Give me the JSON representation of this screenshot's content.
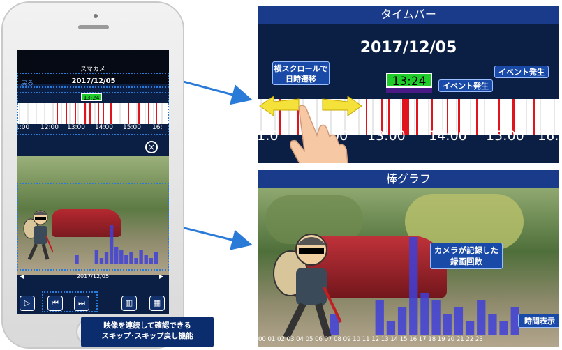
{
  "phone": {
    "app_title": "スマカメ",
    "back_label": "戻る",
    "date": "2017/12/05",
    "now_time": "13:24",
    "time_labels": [
      "1:00",
      "12:00",
      "13:00",
      "14:00",
      "15:00",
      "16:"
    ],
    "close_icon": "close-circle-icon",
    "chart_date": "2017/12/05",
    "nav_prev": "◀",
    "nav_next": "▶",
    "buttons": [
      {
        "name": "play-button",
        "icon": "play-icon",
        "glyph": "▷"
      },
      {
        "name": "skip-back-button",
        "icon": "skip-back-icon",
        "glyph": "⏮"
      },
      {
        "name": "skip-forward-button",
        "icon": "skip-forward-icon",
        "glyph": "⏭"
      },
      {
        "name": "bar-chart-button",
        "icon": "bar-chart-icon",
        "glyph": "▥"
      },
      {
        "name": "calendar-button",
        "icon": "calendar-icon",
        "glyph": "▦"
      }
    ]
  },
  "callout_bottom": {
    "line1": "映像を連続して確認できる",
    "line2": "スキップ･スキップ戻し機能"
  },
  "timebar_panel": {
    "title": "タイムバー",
    "date": "2017/12/05",
    "now_time": "13:24",
    "scroll_tip_line1": "横スクロールで",
    "scroll_tip_line2": "日時遷移",
    "event1": "イベント発生",
    "event2": "イベント発生",
    "time_labels": [
      "1:0",
      "00",
      "13:00",
      "14:00",
      "15:00",
      "16:"
    ]
  },
  "bar_panel": {
    "title": "棒グラフ",
    "camera_tip_line1": "カメラが記録した",
    "camera_tip_line2": "録画回数",
    "time_tip": "時間表示",
    "hours": "00 01 02 03 04 05 06 07 08 09 10 11 12 13 14 15 16 17 18 19 20 21 22 23"
  },
  "colors": {
    "navy": "#0b1e44",
    "panel_title": "#1a3a8a",
    "event_red": "#e0141c",
    "now_green": "#1fcc2a",
    "bar_blue": "#3f3fd8",
    "arrow_blue": "#2a7ad8"
  },
  "chart_data": {
    "type": "bar",
    "categories": [
      "00",
      "01",
      "02",
      "03",
      "04",
      "05",
      "06",
      "07",
      "08",
      "09",
      "10",
      "11",
      "12",
      "13",
      "14",
      "15",
      "16",
      "17",
      "18",
      "19",
      "20",
      "21",
      "22",
      "23"
    ],
    "values": [
      0,
      0,
      0,
      0,
      0,
      0,
      3,
      0,
      0,
      0,
      5,
      2,
      4,
      14,
      6,
      5,
      3,
      4,
      2,
      5,
      3,
      2,
      4,
      0
    ],
    "ylim": [
      0,
      15
    ]
  }
}
